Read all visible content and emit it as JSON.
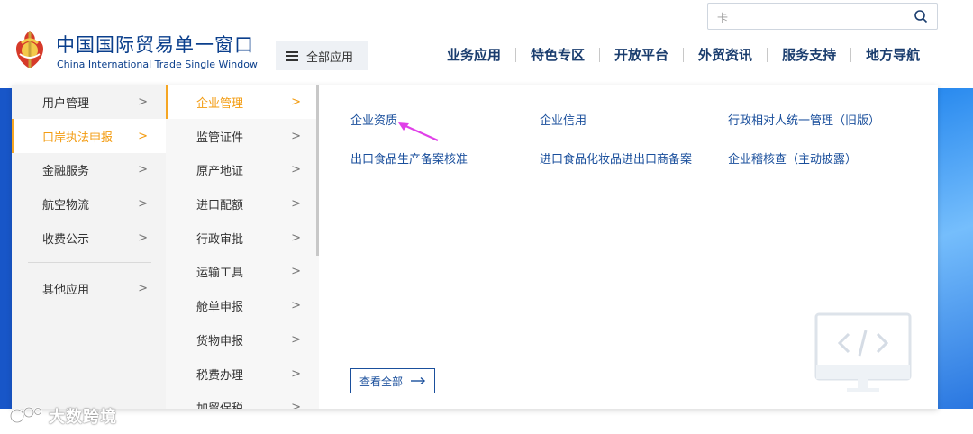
{
  "header": {
    "brand_cn": "中国国际贸易单一窗口",
    "brand_en": "China International Trade Single Window",
    "all_apps_label": "全部应用",
    "search_value": "卡",
    "nav": [
      "业务应用",
      "特色专区",
      "开放平台",
      "外贸资讯",
      "服务支持",
      "地方导航"
    ]
  },
  "menu": {
    "level1": [
      "用户管理",
      "口岸执法申报",
      "金融服务",
      "航空物流",
      "收费公示",
      "其他应用"
    ],
    "level1_active": "口岸执法申报",
    "level2": [
      "企业管理",
      "监管证件",
      "原产地证",
      "进口配额",
      "行政审批",
      "运输工具",
      "舱单申报",
      "货物申报",
      "税费办理",
      "加贸保税"
    ],
    "level2_active": "企业管理",
    "links": [
      "企业资质",
      "企业信用",
      "行政相对人统一管理（旧版）",
      "出口食品生产备案核准",
      "进口食品化妆品进出口商备案",
      "企业稽核查（主动披露）"
    ],
    "view_all": "查看全部",
    "chevron": ">"
  },
  "watermark": "大数跨境",
  "colors": {
    "brand_blue": "#0b3f8c",
    "link_blue": "#1a4f9c",
    "active_orange": "#f39c12",
    "banner_blue": "#1a63d6",
    "arrow_magenta": "#e040e8"
  },
  "icons": [
    "emblem-logo-icon",
    "hamburger-icon",
    "search-icon",
    "chevron-right-icon",
    "arrow-right-icon",
    "code-icon",
    "pointer-arrow-icon"
  ]
}
